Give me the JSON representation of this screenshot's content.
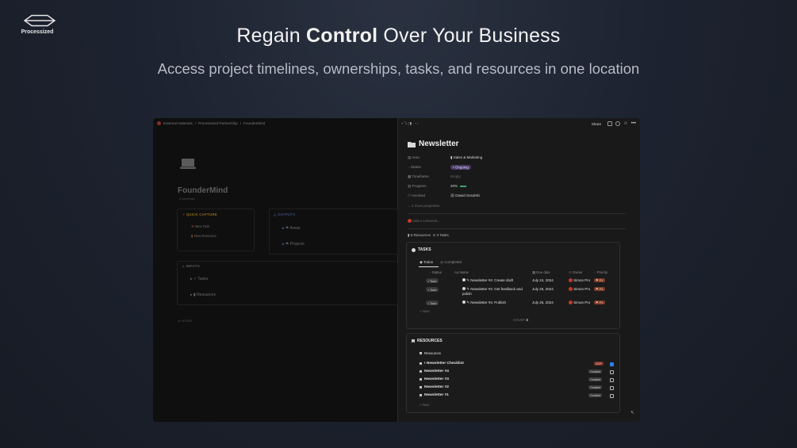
{
  "brand": {
    "name": "Processized"
  },
  "hero": {
    "title_pre": "Regain ",
    "title_bold": "Control",
    "title_post": " Over Your Business",
    "subtitle": "Access project timelines, ownerships, tasks, and resources in one location"
  },
  "left": {
    "breadcrumbs": [
      "External materials",
      "Processized Partnership",
      "FounderMind"
    ],
    "page_title": "FounderMind",
    "page_sub": "4 backlinks",
    "quick_capture": {
      "label": "QUICK CAPTURE",
      "items": [
        "New Task",
        "New Resource"
      ]
    },
    "outputs": {
      "label": "OUTPUTS",
      "items": [
        "Areas",
        "Projects"
      ]
    },
    "inputs": {
      "label": "INPUTS",
      "items": [
        "Tasks",
        "Resources"
      ]
    },
    "archive": "Archive"
  },
  "right": {
    "toolbar": {
      "share": "Share"
    },
    "title": "Newsletter",
    "properties": [
      {
        "name": "Area",
        "value": "Sales & Marketing"
      },
      {
        "name": "Status",
        "value": "Ongoing"
      },
      {
        "name": "Timeframe",
        "value": "Empty"
      },
      {
        "name": "Progress",
        "value": "40%"
      },
      {
        "name": "Involved",
        "value": "Dawid Sosulski"
      }
    ],
    "more_properties": "2 more properties",
    "comment_placeholder": "Add a comment...",
    "counts": {
      "resources": "5 Resources",
      "tasks": "3 Tasks"
    },
    "tasks": {
      "title": "TASKS",
      "tabs": [
        "Todos",
        "Completed"
      ],
      "columns": [
        "Status",
        "Name",
        "Due date",
        "Owner",
        "Priority"
      ],
      "rows": [
        {
          "status": "Todo",
          "name": "Newsletter #4: Create draft",
          "due": "July 24, 2024",
          "owner": "Simon Pro",
          "priority": "P1"
        },
        {
          "status": "Todo",
          "name": "Newsletter #4: Get feedback and polish",
          "due": "July 25, 2024",
          "owner": "Simon Pro",
          "priority": "P1"
        },
        {
          "status": "Todo",
          "name": "Newsletter #4: Publish",
          "due": "July 26, 2024",
          "owner": "Simon Pro",
          "priority": "P1"
        }
      ],
      "new_label": "+ New",
      "count_label": "COUNT",
      "count_value": "3"
    },
    "resources": {
      "title": "RESOURCES",
      "view_label": "Resources",
      "rows": [
        {
          "name": "! Newsletter Checklist",
          "tag": "SOP",
          "checked": true
        },
        {
          "name": "Newsletter #4",
          "tag": "Content",
          "checked": false
        },
        {
          "name": "Newsletter #3",
          "tag": "Content",
          "checked": false
        },
        {
          "name": "Newsletter #2",
          "tag": "Content",
          "checked": false
        },
        {
          "name": "Newsletter #1",
          "tag": "Content",
          "checked": false
        }
      ],
      "new_label": "+ New"
    },
    "colors": {
      "accent_purple": "#4a3a66",
      "todo_grey": "#3a3a3a",
      "priority_red": "#7a3a2a",
      "checkbox_blue": "#2f80ed"
    }
  }
}
